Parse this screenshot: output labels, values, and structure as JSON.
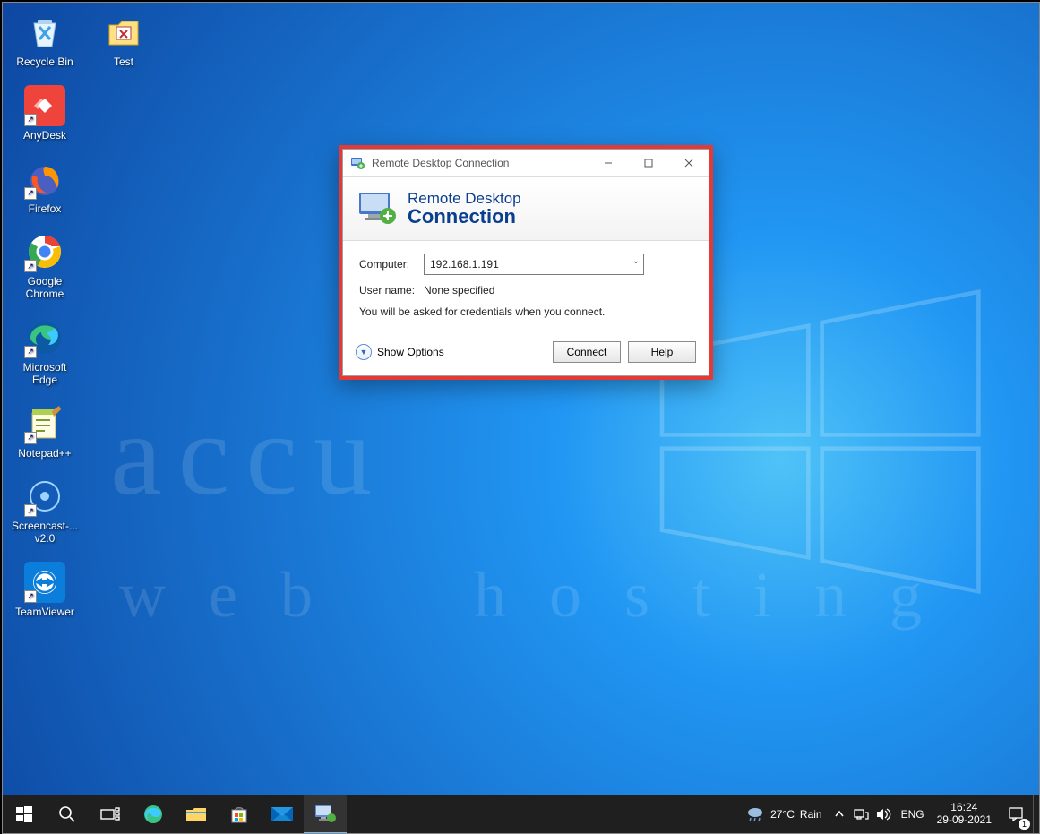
{
  "desktop_icons": [
    {
      "label": "Recycle Bin",
      "kind": "recycle"
    },
    {
      "label": "Test",
      "kind": "folder",
      "col": 2
    },
    {
      "label": "AnyDesk",
      "kind": "anydesk"
    },
    {
      "label": "Firefox",
      "kind": "firefox"
    },
    {
      "label": "Google Chrome",
      "kind": "chrome"
    },
    {
      "label": "Microsoft Edge",
      "kind": "edge"
    },
    {
      "label": "Notepad++",
      "kind": "npp"
    },
    {
      "label": "Screencast-... v2.0",
      "kind": "screencast"
    },
    {
      "label": "TeamViewer",
      "kind": "teamviewer"
    }
  ],
  "dialog": {
    "title": "Remote Desktop Connection",
    "banner_line1": "Remote Desktop",
    "banner_line2": "Connection",
    "computer_label": "Computer:",
    "computer_value": "192.168.1.191",
    "username_label": "User name:",
    "username_value": "None specified",
    "note": "You will be asked for credentials when you connect.",
    "show_options": "Show Options",
    "connect": "Connect",
    "help": "Help"
  },
  "taskbar": {
    "weather_temp": "27°C",
    "weather_label": "Rain",
    "lang": "ENG",
    "time": "16:24",
    "date": "29-09-2021",
    "notif_count": "1"
  },
  "watermark": {
    "line1": "accu",
    "line2": "web  hosting"
  }
}
